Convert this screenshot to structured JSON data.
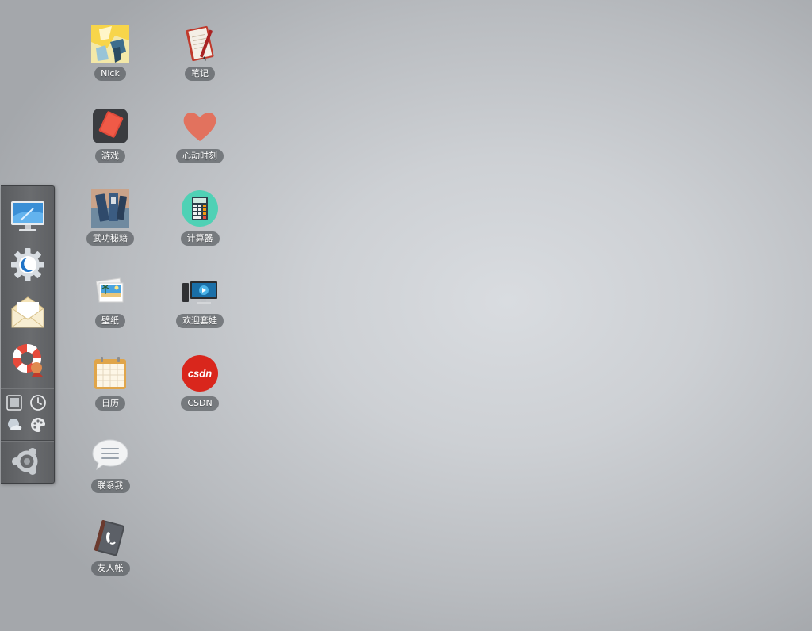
{
  "desktop": {
    "icons": [
      {
        "label": "Nick",
        "icon": "avatar-anime-icon"
      },
      {
        "label": "笔记",
        "icon": "notebook-icon"
      },
      {
        "label": "游戏",
        "icon": "game-icon"
      },
      {
        "label": "心动时刻",
        "icon": "heart-icon"
      },
      {
        "label": "武功秘籍",
        "icon": "books-icon"
      },
      {
        "label": "计算器",
        "icon": "calculator-icon"
      },
      {
        "label": "壁纸",
        "icon": "wallpaper-photos-icon"
      },
      {
        "label": "欢迎套娃",
        "icon": "monitor-icon"
      },
      {
        "label": "日历",
        "icon": "calendar-icon"
      },
      {
        "label": "CSDN",
        "icon": "csdn-logo-icon"
      },
      {
        "label": "联系我",
        "icon": "chat-bubble-icon"
      },
      {
        "label": "友人帐",
        "icon": "address-book-icon"
      }
    ]
  },
  "dock": {
    "apps": [
      {
        "icon": "computer-monitor-icon"
      },
      {
        "icon": "settings-gear-icon"
      },
      {
        "icon": "mail-envelope-icon"
      },
      {
        "icon": "help-lifebuoy-icon"
      }
    ],
    "tools": [
      {
        "icon": "fullscreen-icon"
      },
      {
        "icon": "clock-icon"
      },
      {
        "icon": "weather-icon"
      },
      {
        "icon": "palette-icon"
      }
    ],
    "start": {
      "icon": "ubuntu-start-icon"
    }
  },
  "colors": {
    "heart": "#e2725e",
    "calculator_bg": "#4fd1b5",
    "csdn_red": "#d9261c",
    "dock_bg": "#636568"
  }
}
